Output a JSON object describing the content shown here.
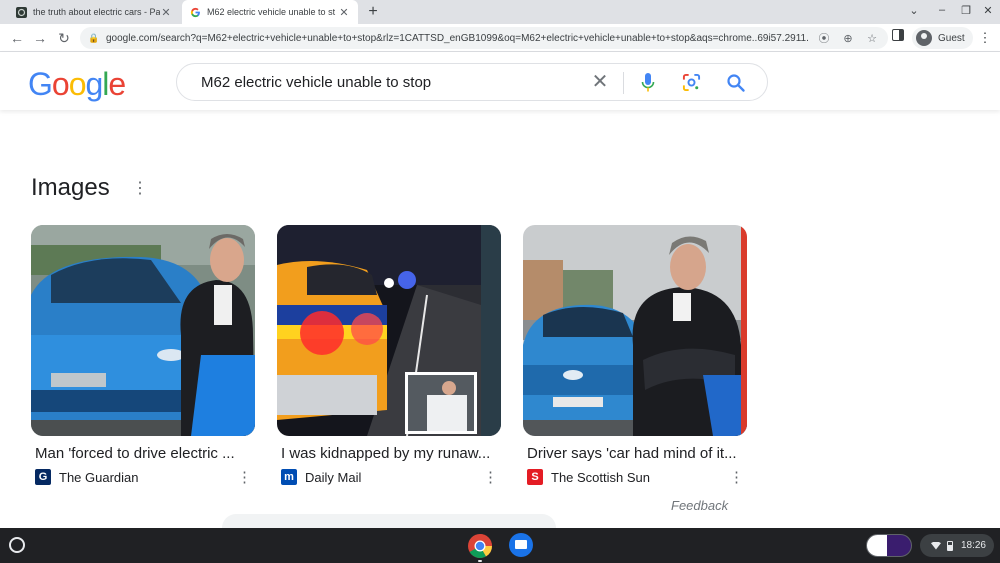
{
  "browser": {
    "tabs": [
      {
        "title": "the truth about electric cars - Pa",
        "active": false,
        "favicon": "dark-square-favicon"
      },
      {
        "title": "M62 electric vehicle unable to st",
        "active": true,
        "favicon": "google-g-favicon"
      }
    ],
    "omnibox": {
      "url": "google.com/search?q=M62+electric+vehicle+unable+to+stop&rlz=1CATTSD_enGB1099&oq=M62+electric+vehicle+unable+to+stop&aqs=chrome..69i57.2911..."
    },
    "profile_label": "Guest",
    "icons": {
      "back": "back-arrow-icon",
      "forward": "forward-arrow-icon",
      "reload": "reload-icon",
      "lock": "lock-icon",
      "location": "location-pin-icon",
      "zoom": "zoom-icon",
      "side_panel": "side-panel-icon",
      "menu": "kebab-menu-icon"
    }
  },
  "google": {
    "logo": {
      "letters": [
        "G",
        "o",
        "o",
        "g",
        "l",
        "e"
      ],
      "colors": [
        "#4285F4",
        "#EA4335",
        "#FBBC05",
        "#4285F4",
        "#34A853",
        "#EA4335"
      ]
    },
    "search": {
      "query": "M62 electric vehicle unable to stop",
      "clear_icon": "close-icon",
      "mic_icon": "microphone-icon",
      "lens_icon": "google-lens-icon",
      "search_icon": "search-icon"
    }
  },
  "images": {
    "heading": "Images",
    "results": [
      {
        "caption": "Man 'forced to drive electric ...",
        "source": "The Guardian",
        "source_icon_glyph": "G",
        "source_icon_color": "#052962",
        "thumbnail": "man-beside-blue-electric-suv-photo"
      },
      {
        "caption": "I was kidnapped by my runaw...",
        "source": "Daily Mail",
        "source_icon_glyph": "m",
        "source_icon_color": "#004db3",
        "thumbnail": "police-car-night-motorway-photo"
      },
      {
        "caption": "Driver says 'car had mind of it...",
        "source": "The Scottish Sun",
        "source_icon_glyph": "S",
        "source_icon_color": "#e41c24",
        "thumbnail": "man-arms-folded-by-blue-car-photo"
      }
    ],
    "feedback": "Feedback"
  },
  "shelf": {
    "time": "18:26",
    "apps": [
      "chrome-app",
      "files-app"
    ]
  },
  "colors": {
    "google_blue": "#4285F4",
    "google_red": "#EA4335",
    "google_yellow": "#FBBC05",
    "google_green": "#34A853",
    "shelf_bg": "#202124"
  }
}
